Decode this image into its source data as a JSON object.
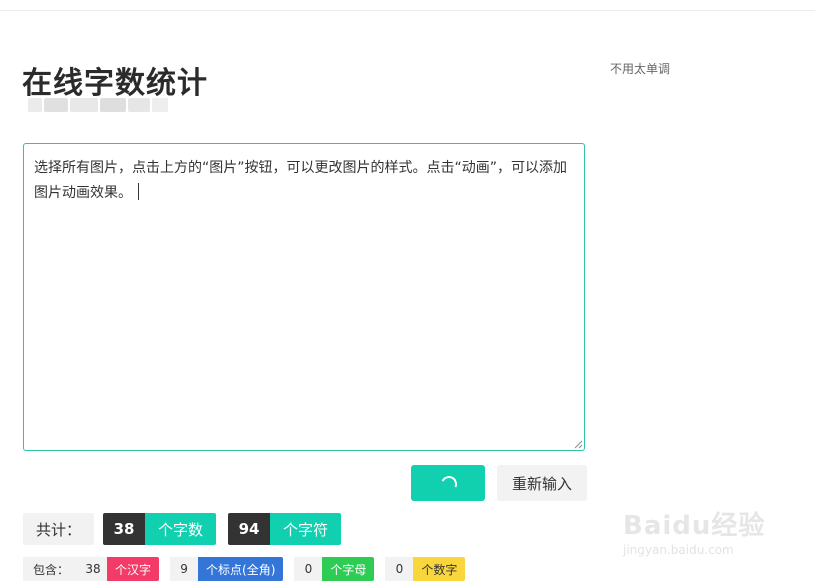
{
  "page": {
    "title": "在线字数统计",
    "side_note": "不用太单调"
  },
  "editor": {
    "text": "选择所有图片，点击上方的“图片”按钮，可以更改图片的样式。点击“动画”，可以添加图片动画效果。"
  },
  "buttons": {
    "loading_state": "spinner",
    "reset_label": "重新输入"
  },
  "totals": {
    "label": "共计：",
    "items": [
      {
        "count": "38",
        "label": "个字数"
      },
      {
        "count": "94",
        "label": "个字符"
      }
    ]
  },
  "contains": {
    "label": "包含：",
    "items": [
      {
        "count": "38",
        "label": "个汉字",
        "color": "#f23b67",
        "text_color": "#ffffff"
      },
      {
        "count": "9",
        "label": "个标点(全角)",
        "color": "#3476d8",
        "text_color": "#ffffff"
      },
      {
        "count": "0",
        "label": "个字母",
        "color": "#2ecc55",
        "text_color": "#ffffff"
      },
      {
        "count": "0",
        "label": "个数字",
        "color": "#f9d63c",
        "text_color": "#333333"
      }
    ]
  },
  "watermark": {
    "brand": "Baidu经验",
    "url": "jingyan.baidu.com"
  },
  "colors": {
    "accent": "#11d0b0",
    "dark": "#333333"
  }
}
